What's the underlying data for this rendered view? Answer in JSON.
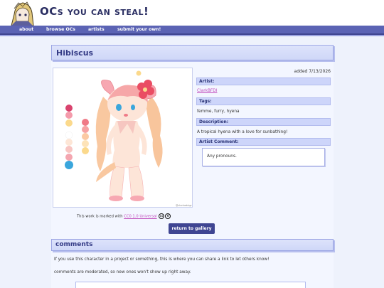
{
  "site": {
    "title": "OCs you can steal!"
  },
  "nav": {
    "items": [
      {
        "label": "about"
      },
      {
        "label": "browse OCs"
      },
      {
        "label": "artists"
      },
      {
        "label": "submit your own!"
      }
    ]
  },
  "oc": {
    "name": "Hibiscus",
    "added": "added 7/13/2026",
    "fields": {
      "artist_label": "Artist:",
      "artist_value": "ClarkBFDI",
      "tags_label": "Tags:",
      "tags_value": "femme, furry, hyena",
      "description_label": "Description:",
      "description_value": "A tropical hyena with a love for sunbathing!",
      "comment_label": "Artist Comment:",
      "comment_value": "Any pronouns."
    },
    "palette": [
      "#d9436e",
      "#f49bab",
      "#fbd98c",
      "#ffffff",
      "#fde6d6",
      "#f8c5c2",
      "#f4a6b0",
      "#3aa6dc"
    ],
    "watermark": "@clarkadsign"
  },
  "license": {
    "prefix": "This work is marked with",
    "link": "CC0 1.0 Universal"
  },
  "buttons": {
    "return": "return to gallery"
  },
  "comments": {
    "title": "comments",
    "line1": "If you use this character in a project or something, this is where you can share a link to let others know!",
    "line2": "comments are moderated, so new ones won't show up right away."
  }
}
